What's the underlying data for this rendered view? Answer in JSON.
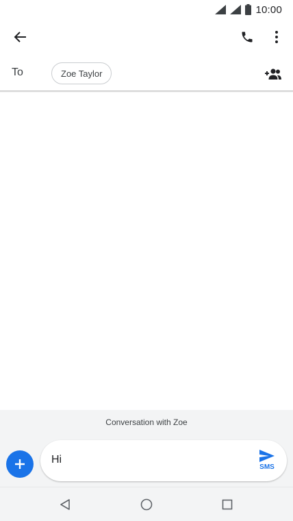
{
  "status_bar": {
    "time": "10:00",
    "icons": [
      "wifi-signal-icon",
      "cell-signal-icon",
      "battery-icon"
    ]
  },
  "app_bar": {
    "icons": [
      "arrow-back-icon",
      "phone-icon",
      "more-vert-icon"
    ]
  },
  "recipients": {
    "to_label": "To",
    "chip_name": "Zoe Taylor",
    "add_icon": "add-people-icon"
  },
  "conversation": {
    "banner": "Conversation with Zoe"
  },
  "compose": {
    "text": "Hi",
    "send_label": "SMS",
    "add_icon": "plus-icon",
    "send_icon": "send-icon"
  },
  "nav_bar": {
    "icons": [
      "back-triangle-icon",
      "home-circle-icon",
      "recents-square-icon"
    ]
  },
  "colors": {
    "accent": "#1a73e8",
    "surface": "#f3f4f5",
    "text": "#202124"
  }
}
